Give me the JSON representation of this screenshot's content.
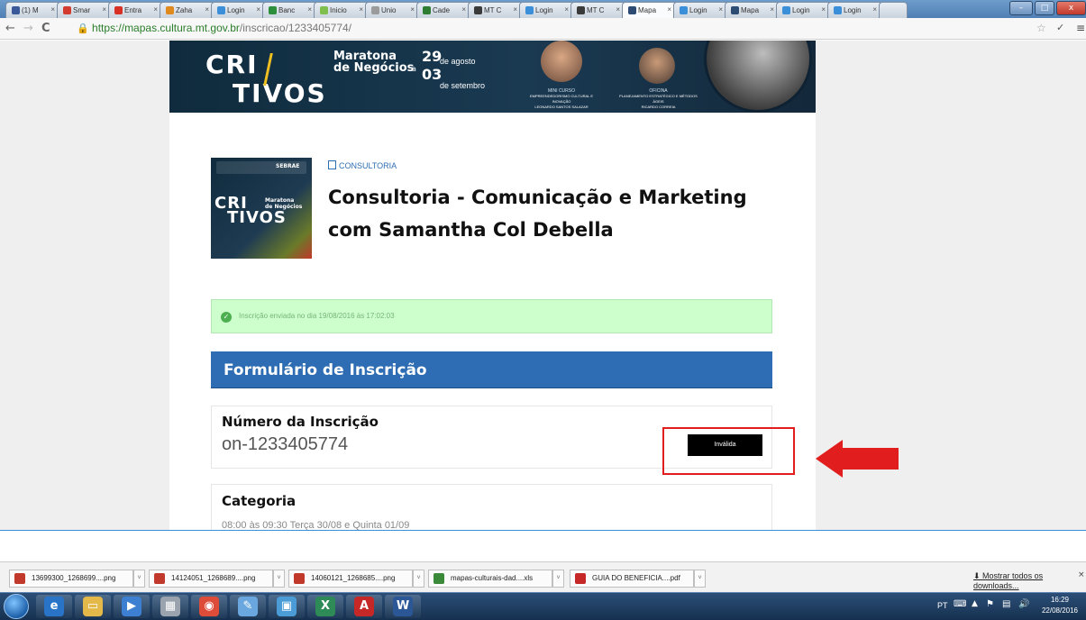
{
  "browser": {
    "tabs": [
      {
        "label": "(1) M",
        "color": "#3b5998"
      },
      {
        "label": "Smar",
        "color": "#d23b2e"
      },
      {
        "label": "Entra",
        "color": "#d93025"
      },
      {
        "label": "Zaha",
        "color": "#e08a1e"
      },
      {
        "label": "Login",
        "color": "#3b8fd8"
      },
      {
        "label": "Banc",
        "color": "#2d8f3c"
      },
      {
        "label": "Inicio",
        "color": "#7fbf4d"
      },
      {
        "label": "Unio",
        "color": "#9b9b9b"
      },
      {
        "label": "Cade",
        "color": "#2e7d32"
      },
      {
        "label": "MT C",
        "color": "#3a3a3a"
      },
      {
        "label": "Login",
        "color": "#3b8fd8"
      },
      {
        "label": "MT C",
        "color": "#3a3a3a"
      },
      {
        "label": "Mapa",
        "color": "#2c4c74"
      },
      {
        "label": "Login",
        "color": "#3b8fd8"
      },
      {
        "label": "Mapa",
        "color": "#2c4c74"
      },
      {
        "label": "Login",
        "color": "#3b8fd8"
      },
      {
        "label": "Login",
        "color": "#3b8fd8"
      }
    ],
    "url_host": "https://mapas.cultura.mt.gov.br",
    "url_path": "/inscricao/1233405774/"
  },
  "banner": {
    "brand_top": "CRI",
    "brand_bottom": "TIVOS",
    "event_line1": "Maratona",
    "event_line2": "de Negócios",
    "date1_num": "29",
    "date1_text": "de agosto",
    "date_sep": "a",
    "date2_num": "03",
    "date2_text": "de setembro",
    "mini_title": "MINI CURSO",
    "mini_text": "EMPREENDEDORISMO CULTURAL E INOVAÇÃO",
    "mini_person": "LEONARDO SANTOS SALAZAR",
    "oficina_title": "OFICINA",
    "oficina_text": "PLANEJAMENTO ESTRATÉGICO E MÉTODOS ÁGEIS",
    "oficina_person": "RICARDO CORREIA"
  },
  "opportunity": {
    "category": "CONSULTORIA",
    "title_line1": "Consultoria - Comunicação e Marketing",
    "title_line2": "com Samantha Col Debella",
    "thumb_brand_top": "CRI",
    "thumb_brand_bottom": "TIVOS",
    "thumb_event1": "Maratona",
    "thumb_event2": "de Negócios",
    "thumb_logo_text": "SEBRAE"
  },
  "status": {
    "message": "Inscrição enviada no dia 19/08/2016 às 17:02:03"
  },
  "form": {
    "header": "Formulário de Inscrição",
    "number_label": "Número da Inscrição",
    "number_value": "on-1233405774",
    "status_badge": "Inválida",
    "category_label": "Categoria",
    "category_value": "08:00 às 09:30 Terça 30/08 e Quinta 01/09"
  },
  "downloads": {
    "items": [
      {
        "name": "13699300_1268699....png",
        "color": "#c0392b"
      },
      {
        "name": "14124051_1268689....png",
        "color": "#c0392b"
      },
      {
        "name": "14060121_1268685....png",
        "color": "#c0392b"
      },
      {
        "name": "mapas-culturais-dad....xls",
        "color": "#3a8a3a"
      },
      {
        "name": "GUIA DO BENEFICIA....pdf",
        "color": "#c62828"
      }
    ],
    "show_all": "Mostrar todos os downloads..."
  },
  "taskbar": {
    "lang": "PT",
    "time": "16:29",
    "date": "22/08/2016",
    "apps": [
      {
        "icon": "ie-icon",
        "glyph": "e",
        "color": "#2a74c8"
      },
      {
        "icon": "explorer-icon",
        "glyph": "▭",
        "color": "#e5b84a"
      },
      {
        "icon": "media-icon",
        "glyph": "▶",
        "color": "#3d7fd0"
      },
      {
        "icon": "calculator-icon",
        "glyph": "▦",
        "color": "#9aa3ad"
      },
      {
        "icon": "chrome-icon",
        "glyph": "◉",
        "color": "#dd4b39"
      },
      {
        "icon": "paint-icon",
        "glyph": "✎",
        "color": "#6aa7de"
      },
      {
        "icon": "screen-icon",
        "glyph": "▣",
        "color": "#4a9bd6"
      },
      {
        "icon": "excel-icon",
        "glyph": "X",
        "color": "#2e8b57"
      },
      {
        "icon": "acrobat-icon",
        "glyph": "A",
        "color": "#c62828"
      },
      {
        "icon": "word-icon",
        "glyph": "W",
        "color": "#2b5797"
      }
    ]
  },
  "colors": {
    "primary_blue": "#2e6db3",
    "success_bg": "#ccffcc",
    "annotation_red": "#e11d1d"
  }
}
